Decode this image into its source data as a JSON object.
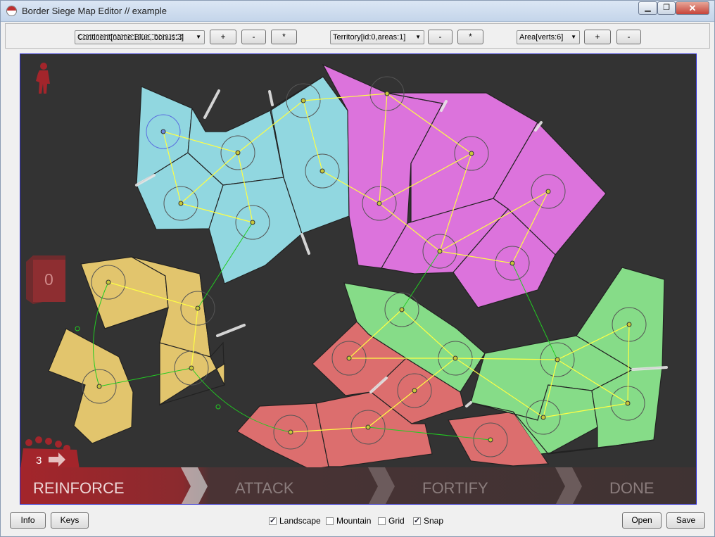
{
  "window": {
    "title": "Border Siege Map Editor // example"
  },
  "toolbar": {
    "continent_select": "Continent[name:Blue, bonus:3]",
    "continent_add": "+",
    "continent_remove": "-",
    "continent_star": "*",
    "territory_select": "Territory[id:0,areas:1]",
    "territory_remove": "-",
    "territory_star": "*",
    "area_select": "Area[verts:6]",
    "area_add": "+",
    "area_remove": "-"
  },
  "hud": {
    "territory_count": "0",
    "reinforcements": "3",
    "phases": [
      "REINFORCE",
      "ATTACK",
      "FORTIFY",
      "DONE"
    ],
    "active_phase": "REINFORCE"
  },
  "bottom": {
    "info_label": "Info",
    "keys_label": "Keys",
    "checkboxes": [
      {
        "label": "Landscape",
        "checked": true
      },
      {
        "label": "Mountain",
        "checked": false
      },
      {
        "label": "Grid",
        "checked": false
      },
      {
        "label": "Snap",
        "checked": true
      }
    ],
    "open_label": "Open",
    "save_label": "Save"
  },
  "colors": {
    "continent_blue": "#91d7e0",
    "continent_magenta": "#dc73dc",
    "continent_yellow": "#e2c56d",
    "continent_red": "#dc6e6e",
    "continent_green": "#86dc88",
    "canvas_bg": "#333333",
    "link_inner": "#ffff44",
    "link_outer": "#22cc22",
    "phase_active": "#a3252b"
  }
}
